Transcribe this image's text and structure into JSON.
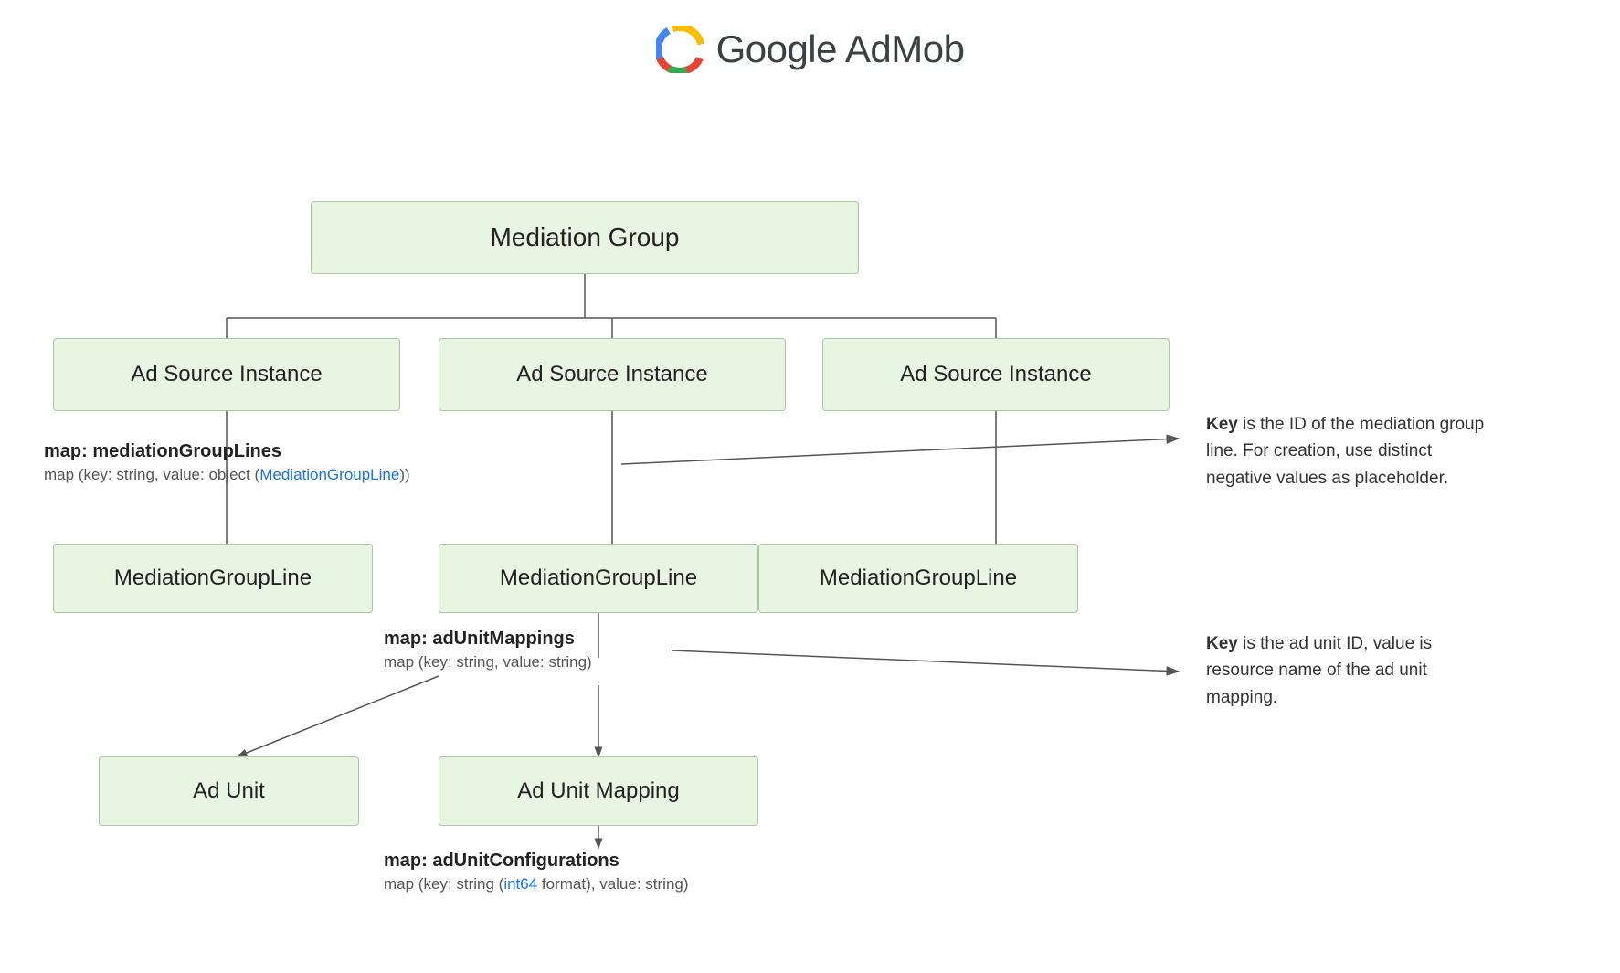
{
  "header": {
    "title": "Google AdMob",
    "logo_alt": "Google AdMob logo"
  },
  "boxes": {
    "mediation_group": "Mediation Group",
    "asi_1": "Ad Source Instance",
    "asi_2": "Ad Source Instance",
    "asi_3": "Ad Source Instance",
    "mgl_1": "MediationGroupLine",
    "mgl_2": "MediationGroupLine",
    "mgl_3": "MediationGroupLine",
    "ad_unit": "Ad Unit",
    "ad_unit_mapping": "Ad Unit Mapping"
  },
  "annotations": {
    "map_mgl_label": "map: mediationGroupLines",
    "map_mgl_detail": "map (key: string, value: object (MediationGroupLine))",
    "map_mgl_link": "MediationGroupLine",
    "map_aum_label": "map: adUnitMappings",
    "map_aum_detail": "map (key: string, value: string)",
    "map_auc_label": "map: adUnitConfigurations",
    "map_auc_detail": "map (key: string (int64 format), value: string)",
    "map_auc_detail_link": "int64"
  },
  "key_annotations": {
    "mgl_key": {
      "bold": "Key",
      "text": " is the ID of the mediation group line. For creation, use distinct negative values as placeholder."
    },
    "aum_key": {
      "bold": "Key",
      "text": " is the ad unit ID, value is resource name of the ad unit mapping."
    }
  }
}
